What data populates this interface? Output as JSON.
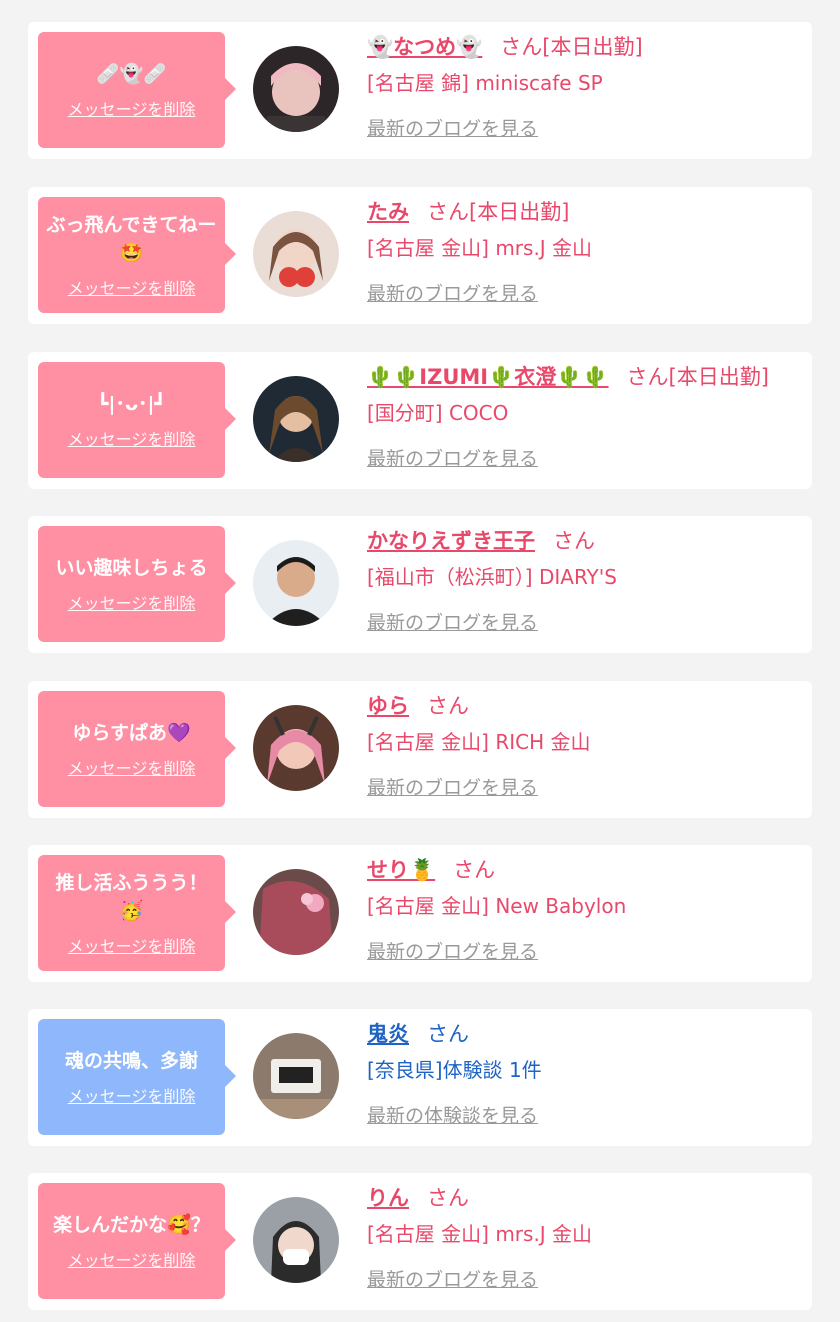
{
  "colors": {
    "bubble_pink": "#ff8fa3",
    "bubble_blue": "#8fb7fb",
    "text_pink": "#e8496b",
    "text_blue": "#1f64c4",
    "link_gray": "#999999",
    "page_bg": "#f3f3f3"
  },
  "delete_label": "メッセージを削除",
  "san_label": "さん",
  "cards": [
    {
      "message": "🩹👻🩹",
      "name": "👻なつめ👻",
      "status": "[本日出勤]",
      "shop": "[名古屋 錦] miniscafe SP",
      "link": "最新のブログを見る",
      "theme": "pink",
      "avatar_icon": "avatar-photo"
    },
    {
      "message": "ぶっ飛んできてねー🤩",
      "name": "たみ",
      "status": "[本日出勤]",
      "shop": "[名古屋 金山] mrs.J 金山",
      "link": "最新のブログを見る",
      "theme": "pink",
      "avatar_icon": "avatar-photo"
    },
    {
      "message": "┗|･ᴗ･|┛",
      "name": "🌵🌵IZUMI🌵衣澄🌵🌵",
      "status": "[本日出勤]",
      "shop": "[国分町] COCO",
      "link": "最新のブログを見る",
      "theme": "pink",
      "avatar_icon": "avatar-photo"
    },
    {
      "message": "いい趣味しちょる",
      "name": "かなりえずき王子",
      "status": "",
      "shop": "[福山市（松浜町）] DIARY'S",
      "link": "最新のブログを見る",
      "theme": "pink",
      "avatar_icon": "avatar-photo"
    },
    {
      "message": "ゆらすぱあ💜",
      "name": "ゆら",
      "status": "",
      "shop": "[名古屋 金山] RICH 金山",
      "link": "最新のブログを見る",
      "theme": "pink",
      "avatar_icon": "avatar-photo"
    },
    {
      "message": "推し活ふううう！🥳",
      "name": "せり🍍",
      "status": "",
      "shop": "[名古屋 金山] New Babylon",
      "link": "最新のブログを見る",
      "theme": "pink",
      "avatar_icon": "avatar-photo"
    },
    {
      "message": "魂の共鳴、多謝",
      "name": "鬼炎",
      "status": "",
      "shop": "[奈良県]体験談 1件",
      "link": "最新の体験談を見る",
      "theme": "blue",
      "avatar_icon": "avatar-photo"
    },
    {
      "message": "楽しんだかな🥰？",
      "name": "りん",
      "status": "",
      "shop": "[名古屋 金山] mrs.J 金山",
      "link": "最新のブログを見る",
      "theme": "pink",
      "avatar_icon": "avatar-photo"
    }
  ]
}
